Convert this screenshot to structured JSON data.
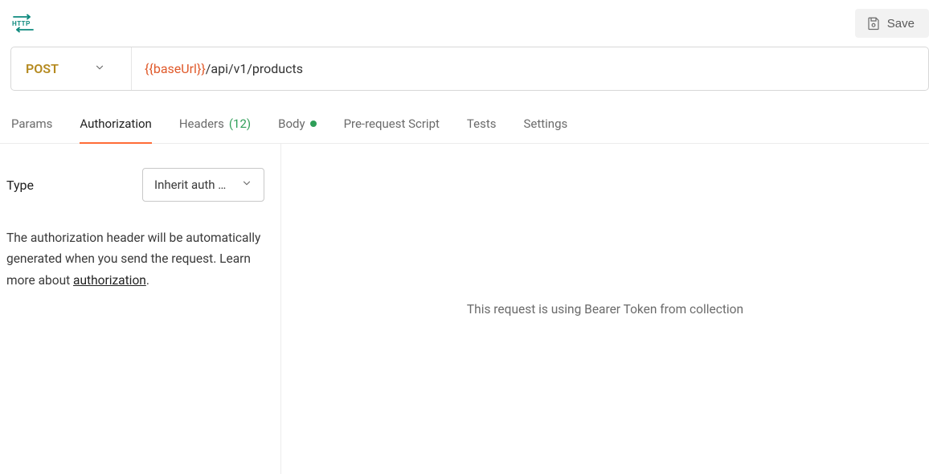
{
  "header": {
    "save_label": "Save"
  },
  "request": {
    "method": "POST",
    "url_variable": "{{baseUrl}}",
    "url_path": "/api/v1/products"
  },
  "tabs": {
    "params": "Params",
    "authorization": "Authorization",
    "headers_label": "Headers",
    "headers_count": "(12)",
    "body": "Body",
    "pre_request": "Pre-request Script",
    "tests": "Tests",
    "settings": "Settings"
  },
  "auth": {
    "type_label": "Type",
    "type_value": "Inherit auth from parent",
    "description_1": "The authorization header will be automatically generated when you send the request. Learn more about ",
    "description_link": "authorization",
    "description_2": "."
  },
  "right": {
    "message": "This request is using Bearer Token from collection"
  }
}
